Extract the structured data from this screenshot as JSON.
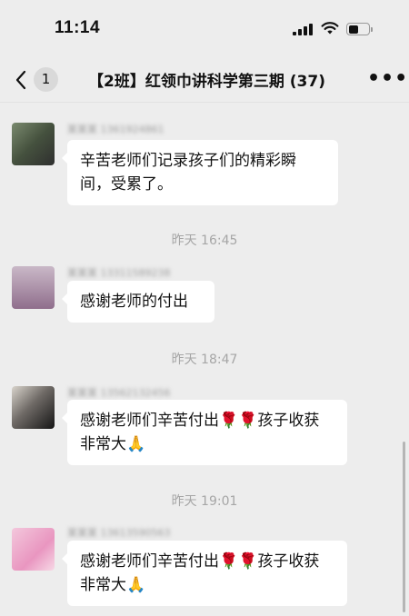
{
  "status_bar": {
    "time": "11:14"
  },
  "nav": {
    "unread_count": "1",
    "title": "【2班】红领巾讲科学第三期 (37)",
    "more_label": "•••"
  },
  "messages": [
    {
      "sender": "某某某 1361924861",
      "text": "辛苦老师们记录孩子们的精彩瞬间，受累了。"
    },
    {
      "sender": "某某某 13311589238",
      "text": "感谢老师的付出"
    },
    {
      "sender": "某某某 13562132456",
      "text": "感谢老师们辛苦付出🌹🌹孩子收获非常大🙏"
    },
    {
      "sender": "某某某 13613590563",
      "text": "感谢老师们辛苦付出🌹🌹孩子收获非常大🙏"
    }
  ],
  "timestamps": [
    "昨天 16:45",
    "昨天 18:47",
    "昨天 19:01"
  ],
  "colors": {
    "background": "#ededed",
    "bubble": "#ffffff",
    "timestamp": "#a6a6a6"
  }
}
